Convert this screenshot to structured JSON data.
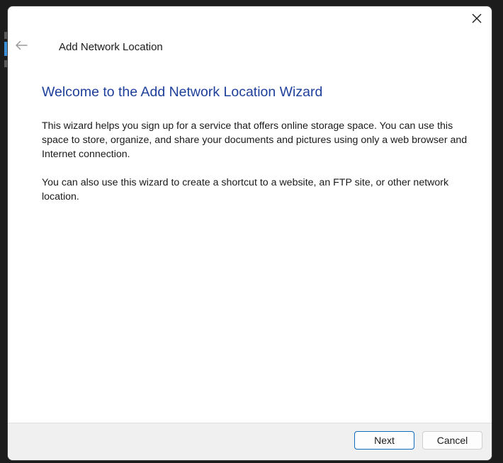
{
  "window": {
    "title": "Add Network Location"
  },
  "icons": {
    "back": "back-arrow-icon",
    "close": "close-icon"
  },
  "wizard": {
    "heading": "Welcome to the Add Network Location Wizard",
    "paragraph1": "This wizard helps you sign up for a service that offers online storage space.  You can use this space to store, organize, and share your documents and pictures using only a web browser and Internet connection.",
    "paragraph2": "You can also use this wizard to create a shortcut to a website, an FTP site, or other network location."
  },
  "footer": {
    "next_label": "Next",
    "cancel_label": "Cancel"
  },
  "colors": {
    "heading": "#1e3f9a",
    "accent_border": "#0f6cbd",
    "footer_bg": "#f0f0f0"
  }
}
